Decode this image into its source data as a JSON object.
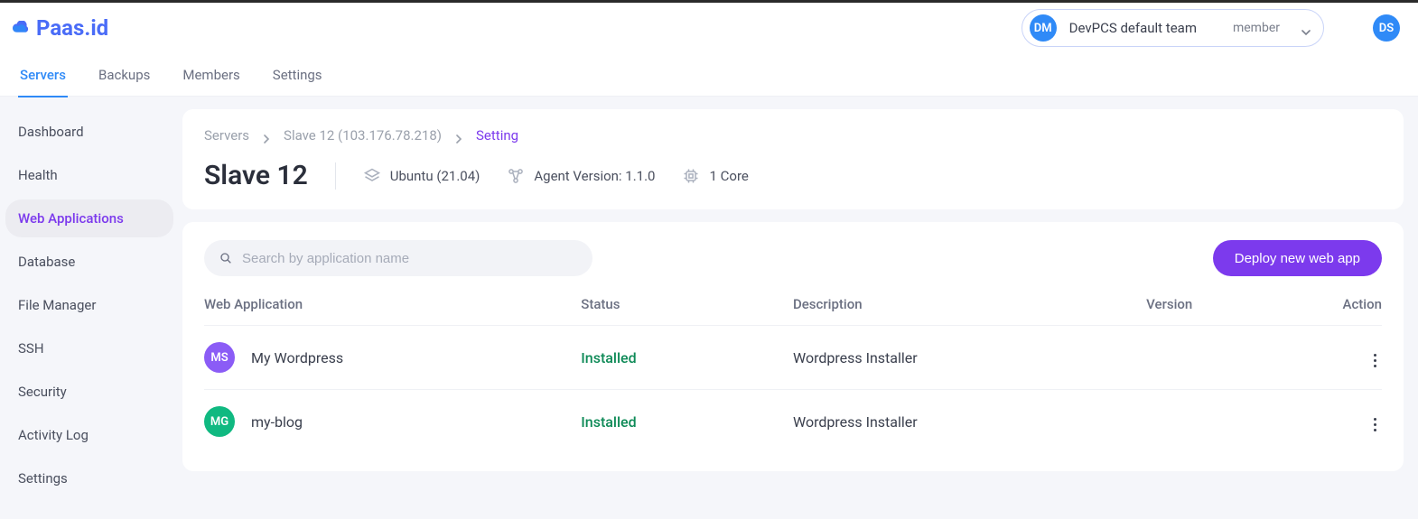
{
  "brand": {
    "name": "Paas.id"
  },
  "team": {
    "avatar_initials": "DM",
    "name": "DevPCS default team",
    "role": "member"
  },
  "user": {
    "avatar_initials": "DS"
  },
  "nav": {
    "tabs": [
      {
        "label": "Servers",
        "active": true
      },
      {
        "label": "Backups",
        "active": false
      },
      {
        "label": "Members",
        "active": false
      },
      {
        "label": "Settings",
        "active": false
      }
    ]
  },
  "sidebar": {
    "items": [
      {
        "label": "Dashboard",
        "active": false
      },
      {
        "label": "Health",
        "active": false
      },
      {
        "label": "Web Applications",
        "active": true
      },
      {
        "label": "Database",
        "active": false
      },
      {
        "label": "File Manager",
        "active": false
      },
      {
        "label": "SSH",
        "active": false
      },
      {
        "label": "Security",
        "active": false
      },
      {
        "label": "Activity Log",
        "active": false
      },
      {
        "label": "Settings",
        "active": false
      }
    ]
  },
  "breadcrumb": {
    "items": [
      "Servers",
      "Slave 12 (103.176.78.218)",
      "Setting"
    ]
  },
  "page": {
    "title": "Slave 12",
    "os": "Ubuntu (21.04)",
    "agent_label": "Agent Version: 1.1.0",
    "cpu": "1 Core"
  },
  "search": {
    "placeholder": "Search by application name"
  },
  "deploy_button": "Deploy new web app",
  "table": {
    "columns": [
      "Web Application",
      "Status",
      "Description",
      "Version",
      "Action"
    ],
    "rows": [
      {
        "avatar_initials": "MS",
        "avatar_color": "#8b5cf6",
        "name": "My Wordpress",
        "status": "Installed",
        "description": "Wordpress Installer",
        "version": ""
      },
      {
        "avatar_initials": "MG",
        "avatar_color": "#10b981",
        "name": "my-blog",
        "status": "Installed",
        "description": "Wordpress Installer",
        "version": ""
      }
    ]
  }
}
